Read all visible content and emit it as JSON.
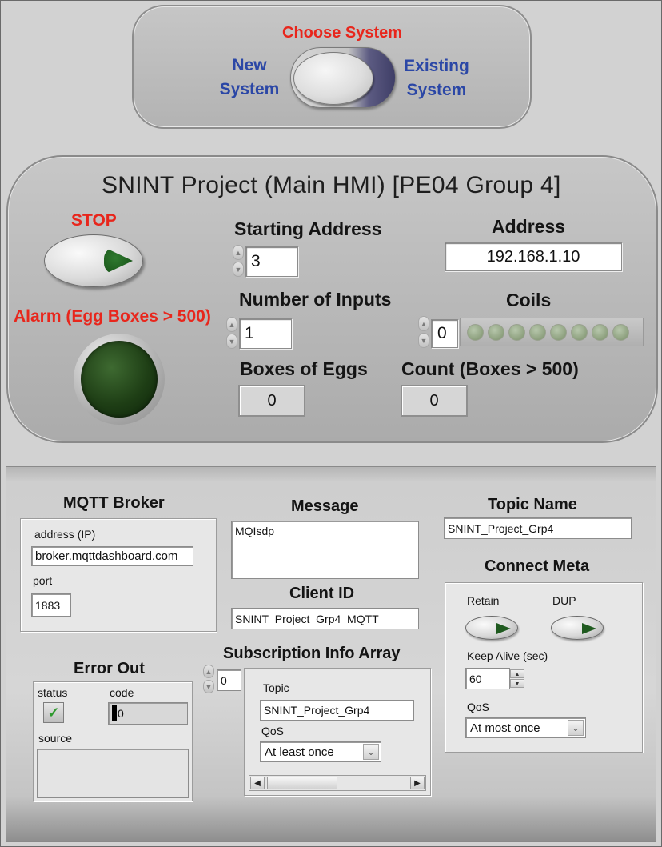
{
  "system_selector": {
    "title": "Choose System",
    "left_option": "New\nSystem",
    "right_option": "Existing\nSystem"
  },
  "hmi": {
    "title": "SNINT Project (Main HMI) [PE04 Group 4]",
    "stop_label": "STOP",
    "alarm_label": "Alarm (Egg Boxes > 500)",
    "starting_address_label": "Starting Address",
    "starting_address_value": "3",
    "number_of_inputs_label": "Number of Inputs",
    "number_of_inputs_value": "1",
    "address_label": "Address",
    "address_value": "192.168.1.10",
    "coils_label": "Coils",
    "coils_index": "0",
    "coils_count": 8,
    "boxes_of_eggs_label": "Boxes of Eggs",
    "boxes_of_eggs_value": "0",
    "count_label": "Count (Boxes > 500)",
    "count_value": "0"
  },
  "mqtt": {
    "broker": {
      "title": "MQTT Broker",
      "address_label": "address (IP)",
      "address_value": "broker.mqttdashboard.com",
      "port_label": "port",
      "port_value": "1883"
    },
    "message": {
      "title": "Message",
      "value": "MQIsdp"
    },
    "client_id": {
      "title": "Client ID",
      "value": "SNINT_Project_Grp4_MQTT"
    },
    "topic_name": {
      "title": "Topic Name",
      "value": "SNINT_Project_Grp4"
    },
    "connect_meta": {
      "title": "Connect Meta",
      "retain_label": "Retain",
      "dup_label": "DUP",
      "keep_alive_label": "Keep Alive (sec)",
      "keep_alive_value": "60",
      "qos_label": "QoS",
      "qos_value": "At most once"
    },
    "subscription": {
      "title": "Subscription Info Array",
      "index": "0",
      "topic_label": "Topic",
      "topic_value": "SNINT_Project_Grp4",
      "qos_label": "QoS",
      "qos_value": "At least once"
    },
    "error_out": {
      "title": "Error Out",
      "status_label": "status",
      "code_label": "code",
      "code_value": "0",
      "source_label": "source",
      "status_icon": "checkmark-icon"
    }
  },
  "colors": {
    "alarm_red": "#e8261c",
    "option_blue": "#2b47a6",
    "led_green": "#1e3e15",
    "coil_led_off": "#8da07e"
  }
}
